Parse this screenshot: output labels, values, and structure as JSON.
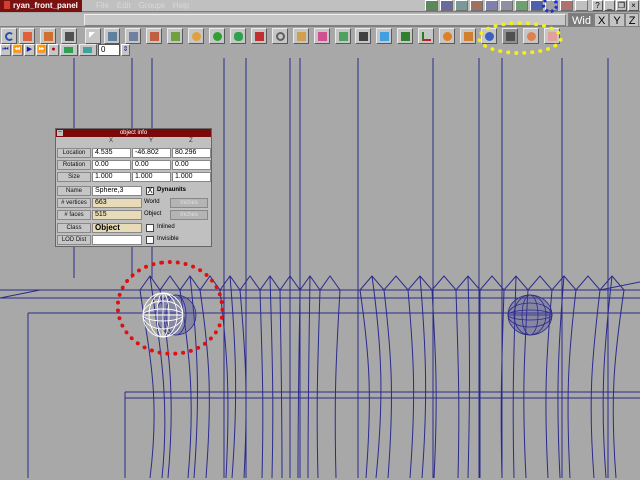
{
  "app": {
    "title": "ryan_front_panel"
  },
  "menu": {
    "items": [
      "File",
      "Edit",
      "Groups",
      "Help"
    ]
  },
  "window_controls": {
    "minimize": "_",
    "restore": "❐",
    "close": "×",
    "help": "?"
  },
  "toolbar": {
    "undo_label": "UNDO",
    "view_axes": [
      "Wid",
      "X",
      "Y",
      "Z"
    ]
  },
  "transport": {
    "buttons": [
      "⏮",
      "⏪",
      "▶",
      "⏩",
      "●"
    ],
    "frame_value": "0"
  },
  "object_info": {
    "title": "object info",
    "column_headers": [
      "X",
      "Y",
      "Z"
    ],
    "location_label": "Location",
    "location": [
      "4.535",
      "-46.802",
      "80.296"
    ],
    "rotation_label": "Rotation",
    "rotation": [
      "0.00",
      "0.00",
      "0.00"
    ],
    "size_label": "Size",
    "size": [
      "1.000",
      "1.000",
      "1.000"
    ],
    "name_label": "Name",
    "name": "Sphere,3",
    "dynaunits_label": "Dynaunits",
    "dynaunits_checked": "X",
    "vertices_label": "# vertices",
    "vertices": "663",
    "faces_label": "# faces",
    "faces": "515",
    "world_label": "World",
    "world_unit": "Inches",
    "object_label": "Object",
    "object_unit": "Inches",
    "class_label": "Class",
    "class_value": "Object",
    "inlined_label": "Inlined",
    "lod_label": "LOD Dist",
    "lod_value": "",
    "invisible_label": "Invisible"
  },
  "colors": {
    "viewport_bg": "#a8a8a8",
    "wire": "#2a2a8c",
    "highlight_selected": "#ffffff",
    "annotation_red": "#e01010",
    "annotation_yellow": "#f5ef1a",
    "annotation_blue": "#1a2fd8",
    "title_bar": "#7a1010"
  }
}
